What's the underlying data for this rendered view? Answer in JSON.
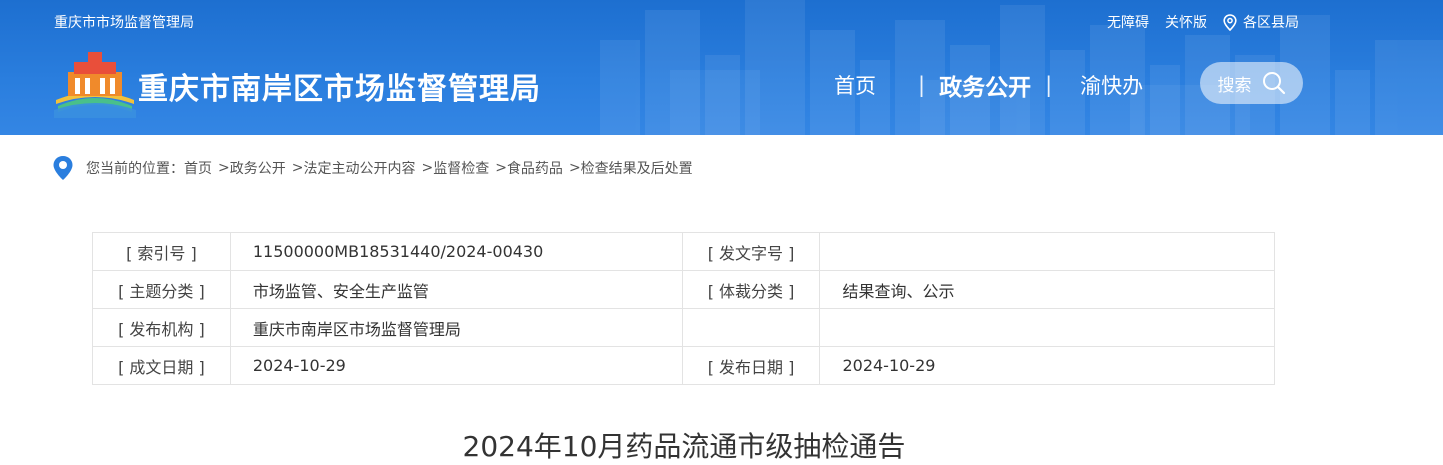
{
  "header": {
    "site_name_small": "重庆市市场监督管理局",
    "top_links": {
      "accessibility": "无障碍",
      "elder": "关怀版",
      "districts": "各区县局"
    },
    "site_title": "重庆市南岸区市场监督管理局",
    "nav": {
      "home": "首页",
      "sep": "|",
      "gov": "政务公开",
      "yukuaiban": "渝快办"
    },
    "search_label": "搜索"
  },
  "breadcrumb": {
    "prefix": "您当前的位置：",
    "items": [
      "首页",
      "政务公开",
      "法定主动公开内容",
      "监督检查",
      "食品药品",
      "检查结果及后处置"
    ],
    "sep": ">"
  },
  "meta": {
    "rows": [
      {
        "l1": "[ 索引号 ]",
        "v1": "11500000MB18531440/2024-00430",
        "l2": "[ 发文字号 ]",
        "v2": ""
      },
      {
        "l1": "[ 主题分类 ]",
        "v1": "市场监管、安全生产监管",
        "l2": "[ 体裁分类 ]",
        "v2": "结果查询、公示"
      },
      {
        "l1": "[ 发布机构 ]",
        "v1": "重庆市南岸区市场监督管理局",
        "l2": "",
        "v2": ""
      },
      {
        "l1": "[ 成文日期 ]",
        "v1": "2024-10-29",
        "l2": "[ 发布日期 ]",
        "v2": "2024-10-29"
      }
    ]
  },
  "article": {
    "title": "2024年10月药品流通市级抽检通告"
  },
  "colors": {
    "header_blue": "#2a7ede",
    "location_icon": "#2a7ede",
    "border": "#e3e3e3"
  }
}
